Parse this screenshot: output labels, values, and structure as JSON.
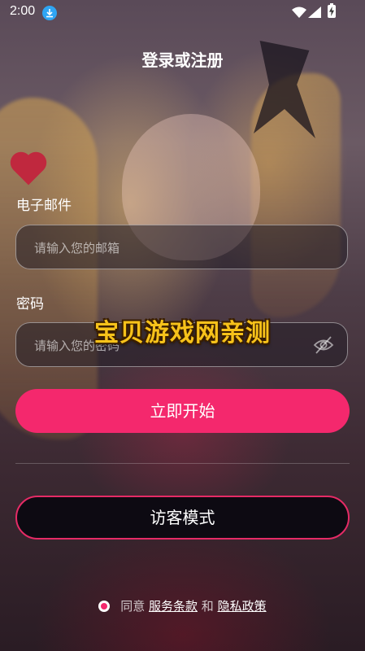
{
  "status_bar": {
    "time": "2:00"
  },
  "header": {
    "title": "登录或注册"
  },
  "email": {
    "label": "电子邮件",
    "placeholder": "请输入您的邮箱"
  },
  "password": {
    "label": "密码",
    "placeholder": "请输入您的密码"
  },
  "watermark": "宝贝游戏网亲测",
  "actions": {
    "start_label": "立即开始",
    "guest_label": "访客模式"
  },
  "agreement": {
    "prefix": "同意",
    "terms": "服务条款",
    "and": "和",
    "privacy": "隐私政策"
  },
  "colors": {
    "accent": "#f4286d",
    "guest_border": "#e52b66",
    "watermark": "#f7c21a"
  },
  "icons": [
    "download-icon",
    "wifi-icon",
    "signal-icon",
    "battery-icon",
    "eye-off-icon"
  ]
}
